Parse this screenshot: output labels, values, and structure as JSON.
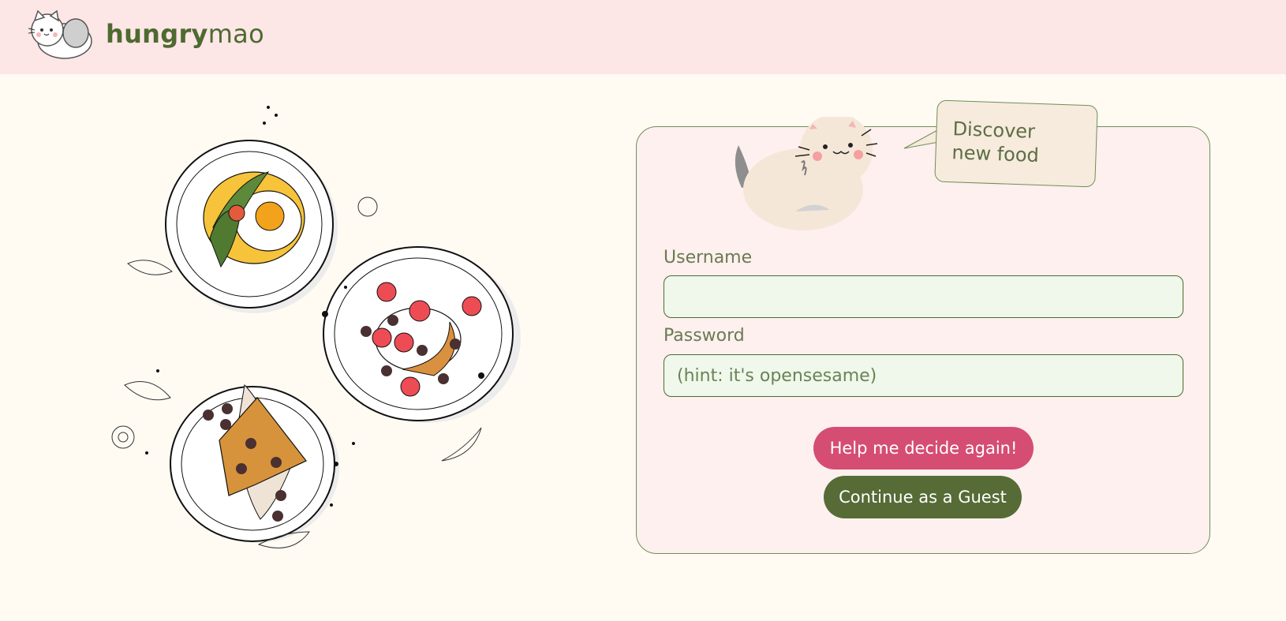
{
  "header": {
    "brand_bold": "hungry",
    "brand_light": "mao",
    "logo_icon": "cat-logo-icon"
  },
  "hero": {
    "illustration": "food-plates-illustration"
  },
  "login": {
    "bubble_line1": "Discover",
    "bubble_line2": "new food",
    "mascot_icon": "cat-mascot-icon",
    "username_label": "Username",
    "username_value": "",
    "username_placeholder": "",
    "password_label": "Password",
    "password_value": "",
    "password_placeholder": "(hint: it's opensesame)",
    "decide_button": "Help me decide again!",
    "guest_button": "Continue as a Guest"
  },
  "colors": {
    "header_bg": "#fce6e6",
    "page_bg": "#fffbf3",
    "brand_green": "#4e6a30",
    "card_bg": "#fdf0ee",
    "input_bg": "#eff8ea",
    "accent_pink": "#d54d73",
    "guest_green": "#566b36"
  }
}
